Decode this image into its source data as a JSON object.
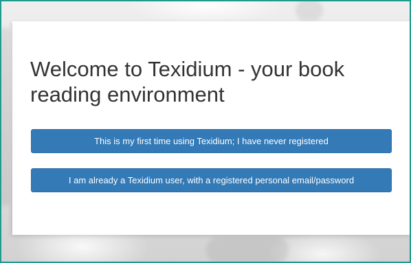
{
  "welcome": {
    "heading": "Welcome to Texidium - your book reading environment"
  },
  "actions": {
    "first_time_label": "This is my first time using Texidium; I have never registered",
    "existing_user_label": "I am already a Texidium user, with a registered personal email/password"
  },
  "colors": {
    "button_primary": "#337ab7",
    "frame_border": "#1f9b8c",
    "heading_text": "#333333"
  }
}
